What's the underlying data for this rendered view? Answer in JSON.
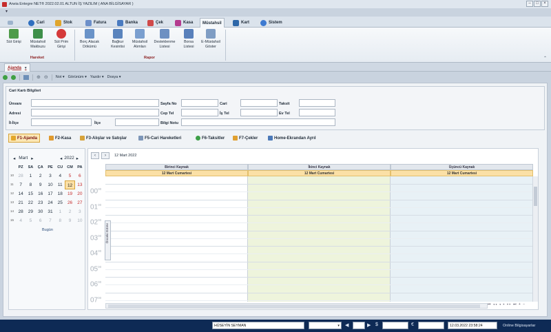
{
  "app": {
    "title": "Arwia Entegre NET® 2022.02.01 ALTUN İŞ YAZILIM ( ANA BİLGİSAYAR )"
  },
  "ribbon_tabs": [
    {
      "label": "Cari",
      "icon": "person-icon"
    },
    {
      "label": "Stok",
      "icon": "box-icon"
    },
    {
      "label": "Fatura",
      "icon": "invoice-icon"
    },
    {
      "label": "Banka",
      "icon": "bank-icon"
    },
    {
      "label": "Çek",
      "icon": "check-icon"
    },
    {
      "label": "Kasa",
      "icon": "cashbox-icon"
    },
    {
      "label": "Müstahsil",
      "icon": "",
      "active": true
    },
    {
      "label": "Kart",
      "icon": "card-icon"
    },
    {
      "label": "Sistem",
      "icon": "gear-icon"
    }
  ],
  "ribbon": {
    "hareket_buttons": [
      "Süt Girişi",
      "Müstahsil Makbuzu",
      "Süt Prim Girişi"
    ],
    "rapor_buttons": [
      "Borç Alacak Dökümü",
      "Bağkur Kesintisi",
      "Müstahsil Alımları",
      "Desteklenme Listesi",
      "Borsa Listesi",
      "E-Müstahsil Göster"
    ],
    "groups": {
      "hareket": "Hareket",
      "rapor": "Rapor"
    }
  },
  "doc_tab": {
    "label": "Ajanda"
  },
  "toolbar": {
    "items": [
      "Not",
      "Görünüm",
      "Yazdır",
      "Dosya"
    ]
  },
  "cari_panel": {
    "title": "Cari Kartı Bilgileri",
    "labels": {
      "unvan": "Ünvanı",
      "adres": "Adresi",
      "il_ilce": "İl-İlçe",
      "ilce": "İlçe",
      "sayfa_no": "Sayfa No",
      "cep_tel": "Cep Tel",
      "bilgi_notu": "Bilgi Notu",
      "cari": "Cari",
      "is_tel": "İş Tel",
      "taksit": "Taksit",
      "ev_tel": "Ev Tel"
    }
  },
  "function_tabs": [
    "F1-Ajanda",
    "F2-Kasa",
    "F3-Alışlar ve Satışlar",
    "F5-Cari Hareketleri",
    "F6-Taksitler",
    "F7-Çekler",
    "Home-Ekrandan Ayrıl"
  ],
  "calendar": {
    "month": "Mart",
    "year": "2022",
    "weekdays": [
      "PZ",
      "SA",
      "ÇA",
      "PE",
      "CU",
      "CM",
      "PA"
    ],
    "week_numbers": [
      "10",
      "11",
      "12",
      "13",
      "14",
      "15"
    ],
    "rows": [
      [
        "28",
        "1",
        "2",
        "3",
        "4",
        "5",
        "6"
      ],
      [
        "7",
        "8",
        "9",
        "10",
        "11",
        "12",
        "13"
      ],
      [
        "14",
        "15",
        "16",
        "17",
        "18",
        "19",
        "20"
      ],
      [
        "21",
        "22",
        "23",
        "24",
        "25",
        "26",
        "27"
      ],
      [
        "28",
        "29",
        "30",
        "31",
        "1",
        "2",
        "3"
      ],
      [
        "4",
        "5",
        "6",
        "7",
        "8",
        "9",
        "10"
      ]
    ],
    "selected": "12",
    "today_label": "Bugün"
  },
  "scheduler": {
    "date_label": "12 Mart 2022",
    "resources": [
      "Birinci Kaynak",
      "İkinci Kaynak",
      "Üçüncü Kaynak"
    ],
    "day_header": "12 Mart Cumartesi",
    "hours": [
      "00",
      "01",
      "02",
      "03",
      "04",
      "05",
      "06",
      "07"
    ],
    "minute_suffix": "00",
    "side_tab": "Önceki Görev"
  },
  "status": {
    "user": "HÜSEYİN SEYMAN",
    "datetime": "12.03.2022  23:58:24",
    "online": "Online Bilgisayarlar"
  },
  "colors": {
    "accent": "#fbe0a6",
    "status_bg": "#0e2a55",
    "active_tab": "#a02323"
  }
}
